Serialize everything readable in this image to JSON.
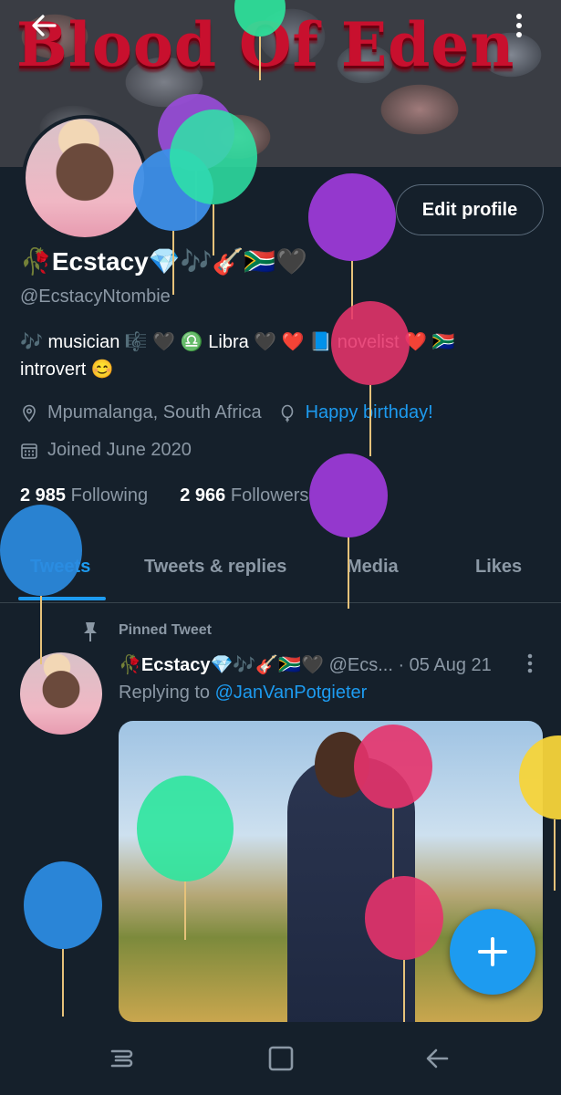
{
  "banner": {
    "title": "Blood Of Eden"
  },
  "profile": {
    "edit_label": "Edit profile",
    "name": "🥀Ecstacy💎🎶🎸🇿🇦🖤",
    "handle": "@EcstacyNtombie",
    "bio_line1": "🎶 musician 🎼 🖤 ♎ Libra 🖤 ❤️ 📘 novelist ❤️ 🇿🇦",
    "bio_line2": "introvert 😊",
    "location": "Mpumalanga, South Africa",
    "birthday": "Happy birthday!",
    "joined": "Joined June 2020",
    "following_count": "2 985",
    "following_label": "Following",
    "followers_count": "2 966",
    "followers_label": "Followers"
  },
  "tabs": [
    "Tweets",
    "Tweets & replies",
    "Media",
    "Likes"
  ],
  "pinned": {
    "label": "Pinned Tweet",
    "name": "🥀Ecstacy💎🎶🎸🇿🇦🖤",
    "handle": "@Ecs...",
    "date": "· 05 Aug 21",
    "replying_prefix": "Replying to",
    "replying_to": "@JanVanPotgieter"
  },
  "icons": {
    "back": "arrow-left-icon",
    "more": "more-vertical-icon",
    "location": "location-pin-icon",
    "birthday": "balloon-icon",
    "calendar": "calendar-icon",
    "pin": "pin-icon",
    "compose": "plus-icon"
  },
  "colors": {
    "accent": "#1d9bf0",
    "background": "#15202b",
    "banner_text": "#c8102e"
  }
}
